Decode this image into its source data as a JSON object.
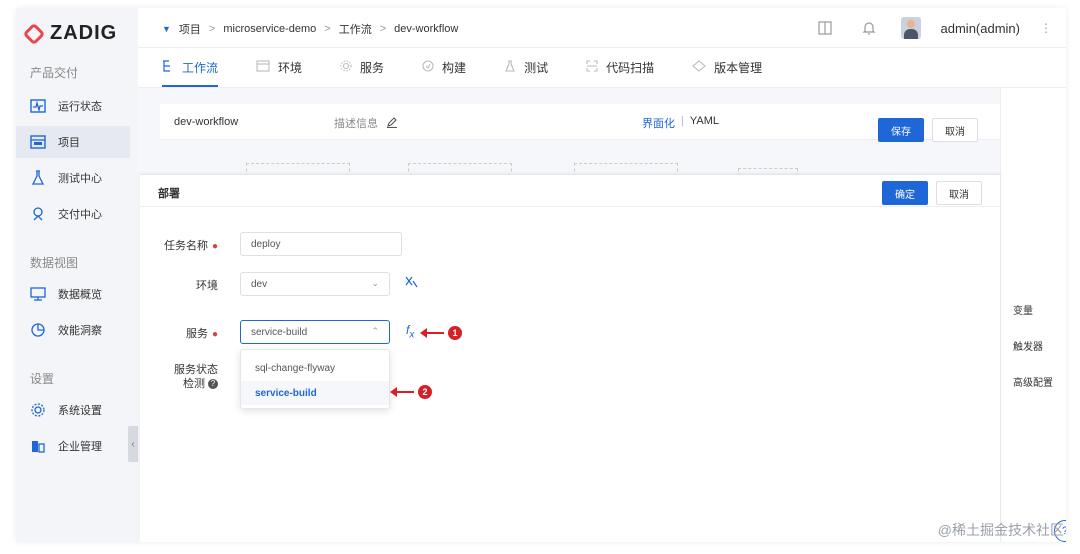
{
  "sidebar": {
    "logo_text": "ZADIG",
    "section_delivery": "产品交付",
    "section_data": "数据视图",
    "section_settings": "设置",
    "items": [
      {
        "label": "运行状态",
        "icon": "pulse-icon"
      },
      {
        "label": "项目",
        "icon": "project-icon"
      },
      {
        "label": "测试中心",
        "icon": "flask-icon"
      },
      {
        "label": "交付中心",
        "icon": "delivery-icon"
      },
      {
        "label": "数据概览",
        "icon": "monitor-icon"
      },
      {
        "label": "效能洞察",
        "icon": "pie-icon"
      },
      {
        "label": "系统设置",
        "icon": "gear-icon"
      },
      {
        "label": "企业管理",
        "icon": "building-icon"
      }
    ]
  },
  "topbar": {
    "breadcrumb": [
      "项目",
      "microservice-demo",
      "工作流",
      "dev-workflow"
    ],
    "user": "admin(admin)"
  },
  "tabs": [
    {
      "label": "工作流",
      "active": true
    },
    {
      "label": "环境",
      "active": false
    },
    {
      "label": "服务",
      "active": false
    },
    {
      "label": "构建",
      "active": false
    },
    {
      "label": "测试",
      "active": false
    },
    {
      "label": "代码扫描",
      "active": false
    },
    {
      "label": "版本管理",
      "active": false
    }
  ],
  "workflow": {
    "name": "dev-workflow",
    "desc_label": "描述信息",
    "mode_ui": "界面化",
    "mode_yaml": "YAML",
    "save": "保存",
    "cancel": "取消"
  },
  "right_panel": {
    "variables": "变量",
    "triggers": "触发器",
    "advanced": "高级配置"
  },
  "deploy": {
    "title": "部署",
    "confirm": "确定",
    "cancel": "取消",
    "task_name_label": "任务名称",
    "task_name_value": "deploy",
    "env_label": "环境",
    "env_value": "dev",
    "service_label": "服务",
    "service_value": "service-build",
    "status_label_1": "服务状态",
    "status_label_2": "检测",
    "options": [
      "sql-change-flyway",
      "service-build"
    ],
    "selected_option": "service-build"
  },
  "annotations": {
    "marker_1": "1",
    "marker_2": "2",
    "accent": "#d61f26"
  },
  "watermark": "@稀土掘金技术社区",
  "colors": {
    "primary": "#1f66d7",
    "required": "#e23b3b"
  }
}
